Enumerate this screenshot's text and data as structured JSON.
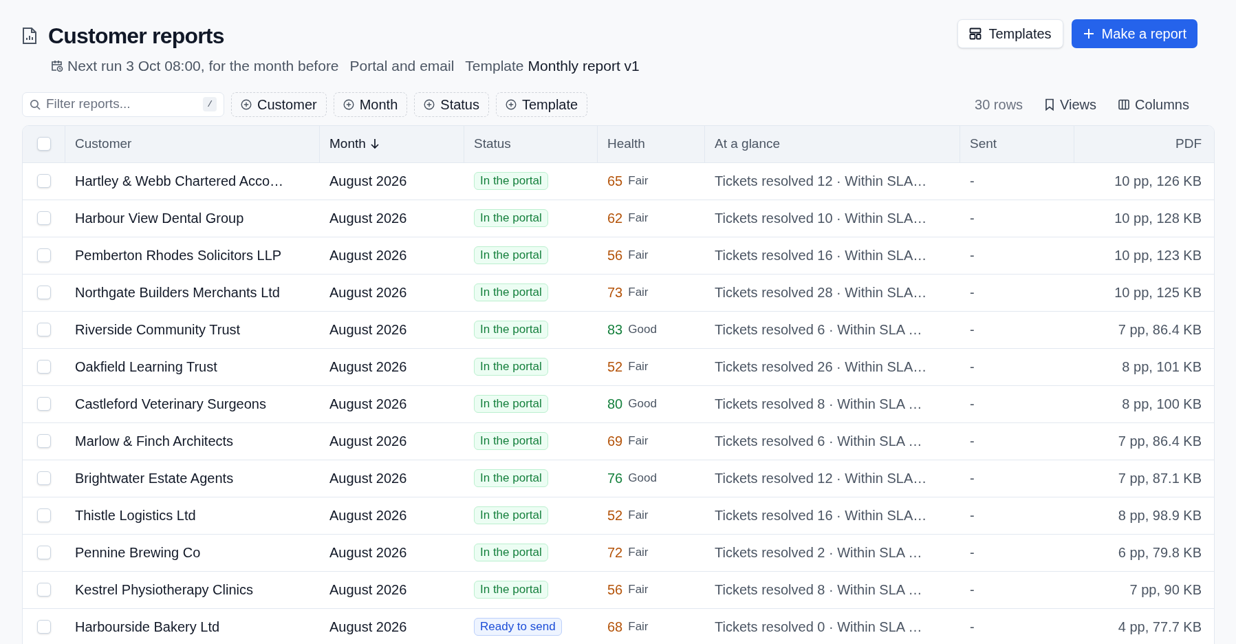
{
  "header": {
    "title": "Customer reports",
    "next_run": "Next run 3 Oct 08:00, for the month before",
    "delivery": "Portal and email",
    "template_label": "Template",
    "template_name": "Monthly report v1"
  },
  "actions": [
    {
      "kind": "templates",
      "label": "Templates"
    },
    {
      "kind": "primary",
      "label": "Make a report"
    }
  ],
  "toolbar": {
    "search": {
      "placeholder": "Filter reports...",
      "shortcut": "/"
    },
    "filters": [
      "Customer",
      "Month",
      "Status",
      "Template"
    ],
    "row_count": "30 rows",
    "views": "Views",
    "columns": "Columns"
  },
  "table": {
    "select_all_checked": false,
    "columns": [
      {
        "label": "Customer",
        "sorted": false
      },
      {
        "label": "Month",
        "sorted": true
      },
      {
        "label": "Status",
        "sorted": false
      },
      {
        "label": "Health",
        "sorted": false
      },
      {
        "label": "At a glance",
        "sorted": false
      },
      {
        "label": "Sent",
        "sorted": false
      },
      {
        "label": "PDF",
        "sorted": false
      }
    ],
    "rows": [
      {
        "checked": false,
        "customer": "Hartley & Webb Chartered Acco…",
        "month": "August 2026",
        "status": {
          "kind": "portal",
          "label": "In the portal"
        },
        "score": "65",
        "health": {
          "kind": "fair",
          "label": "Fair"
        },
        "glance": "Tickets resolved 12 · Within SLA…",
        "sent": "-",
        "pdf": "10 pp, 126 KB"
      },
      {
        "checked": false,
        "customer": "Harbour View Dental Group",
        "month": "August 2026",
        "status": {
          "kind": "portal",
          "label": "In the portal"
        },
        "score": "62",
        "health": {
          "kind": "fair",
          "label": "Fair"
        },
        "glance": "Tickets resolved 10 · Within SLA…",
        "sent": "-",
        "pdf": "10 pp, 128 KB"
      },
      {
        "checked": false,
        "customer": "Pemberton Rhodes Solicitors LLP",
        "month": "August 2026",
        "status": {
          "kind": "portal",
          "label": "In the portal"
        },
        "score": "56",
        "health": {
          "kind": "fair",
          "label": "Fair"
        },
        "glance": "Tickets resolved 16 · Within SLA…",
        "sent": "-",
        "pdf": "10 pp, 123 KB"
      },
      {
        "checked": false,
        "customer": "Northgate Builders Merchants Ltd",
        "month": "August 2026",
        "status": {
          "kind": "portal",
          "label": "In the portal"
        },
        "score": "73",
        "health": {
          "kind": "fair",
          "label": "Fair"
        },
        "glance": "Tickets resolved 28 · Within SLA…",
        "sent": "-",
        "pdf": "10 pp, 125 KB"
      },
      {
        "checked": false,
        "customer": "Riverside Community Trust",
        "month": "August 2026",
        "status": {
          "kind": "portal",
          "label": "In the portal"
        },
        "score": "83",
        "health": {
          "kind": "good",
          "label": "Good"
        },
        "glance": "Tickets resolved 6 · Within SLA …",
        "sent": "-",
        "pdf": "7 pp, 86.4 KB"
      },
      {
        "checked": false,
        "customer": "Oakfield Learning Trust",
        "month": "August 2026",
        "status": {
          "kind": "portal",
          "label": "In the portal"
        },
        "score": "52",
        "health": {
          "kind": "fair",
          "label": "Fair"
        },
        "glance": "Tickets resolved 26 · Within SLA…",
        "sent": "-",
        "pdf": "8 pp, 101 KB"
      },
      {
        "checked": false,
        "customer": "Castleford Veterinary Surgeons",
        "month": "August 2026",
        "status": {
          "kind": "portal",
          "label": "In the portal"
        },
        "score": "80",
        "health": {
          "kind": "good",
          "label": "Good"
        },
        "glance": "Tickets resolved 8 · Within SLA …",
        "sent": "-",
        "pdf": "8 pp, 100 KB"
      },
      {
        "checked": false,
        "customer": "Marlow & Finch Architects",
        "month": "August 2026",
        "status": {
          "kind": "portal",
          "label": "In the portal"
        },
        "score": "69",
        "health": {
          "kind": "fair",
          "label": "Fair"
        },
        "glance": "Tickets resolved 6 · Within SLA …",
        "sent": "-",
        "pdf": "7 pp, 86.4 KB"
      },
      {
        "checked": false,
        "customer": "Brightwater Estate Agents",
        "month": "August 2026",
        "status": {
          "kind": "portal",
          "label": "In the portal"
        },
        "score": "76",
        "health": {
          "kind": "good",
          "label": "Good"
        },
        "glance": "Tickets resolved 12 · Within SLA…",
        "sent": "-",
        "pdf": "7 pp, 87.1 KB"
      },
      {
        "checked": false,
        "customer": "Thistle Logistics Ltd",
        "month": "August 2026",
        "status": {
          "kind": "portal",
          "label": "In the portal"
        },
        "score": "52",
        "health": {
          "kind": "fair",
          "label": "Fair"
        },
        "glance": "Tickets resolved 16 · Within SLA…",
        "sent": "-",
        "pdf": "8 pp, 98.9 KB"
      },
      {
        "checked": false,
        "customer": "Pennine Brewing Co",
        "month": "August 2026",
        "status": {
          "kind": "portal",
          "label": "In the portal"
        },
        "score": "72",
        "health": {
          "kind": "fair",
          "label": "Fair"
        },
        "glance": "Tickets resolved 2 · Within SLA …",
        "sent": "-",
        "pdf": "6 pp, 79.8 KB"
      },
      {
        "checked": false,
        "customer": "Kestrel Physiotherapy Clinics",
        "month": "August 2026",
        "status": {
          "kind": "portal",
          "label": "In the portal"
        },
        "score": "56",
        "health": {
          "kind": "fair",
          "label": "Fair"
        },
        "glance": "Tickets resolved 8 · Within SLA …",
        "sent": "-",
        "pdf": "7 pp, 90 KB"
      },
      {
        "checked": false,
        "customer": "Harbourside Bakery Ltd",
        "month": "August 2026",
        "status": {
          "kind": "ready",
          "label": "Ready to send"
        },
        "score": "68",
        "health": {
          "kind": "fair",
          "label": "Fair"
        },
        "glance": "Tickets resolved 0 · Within SLA …",
        "sent": "-",
        "pdf": "4 pp, 77.7 KB"
      }
    ]
  }
}
